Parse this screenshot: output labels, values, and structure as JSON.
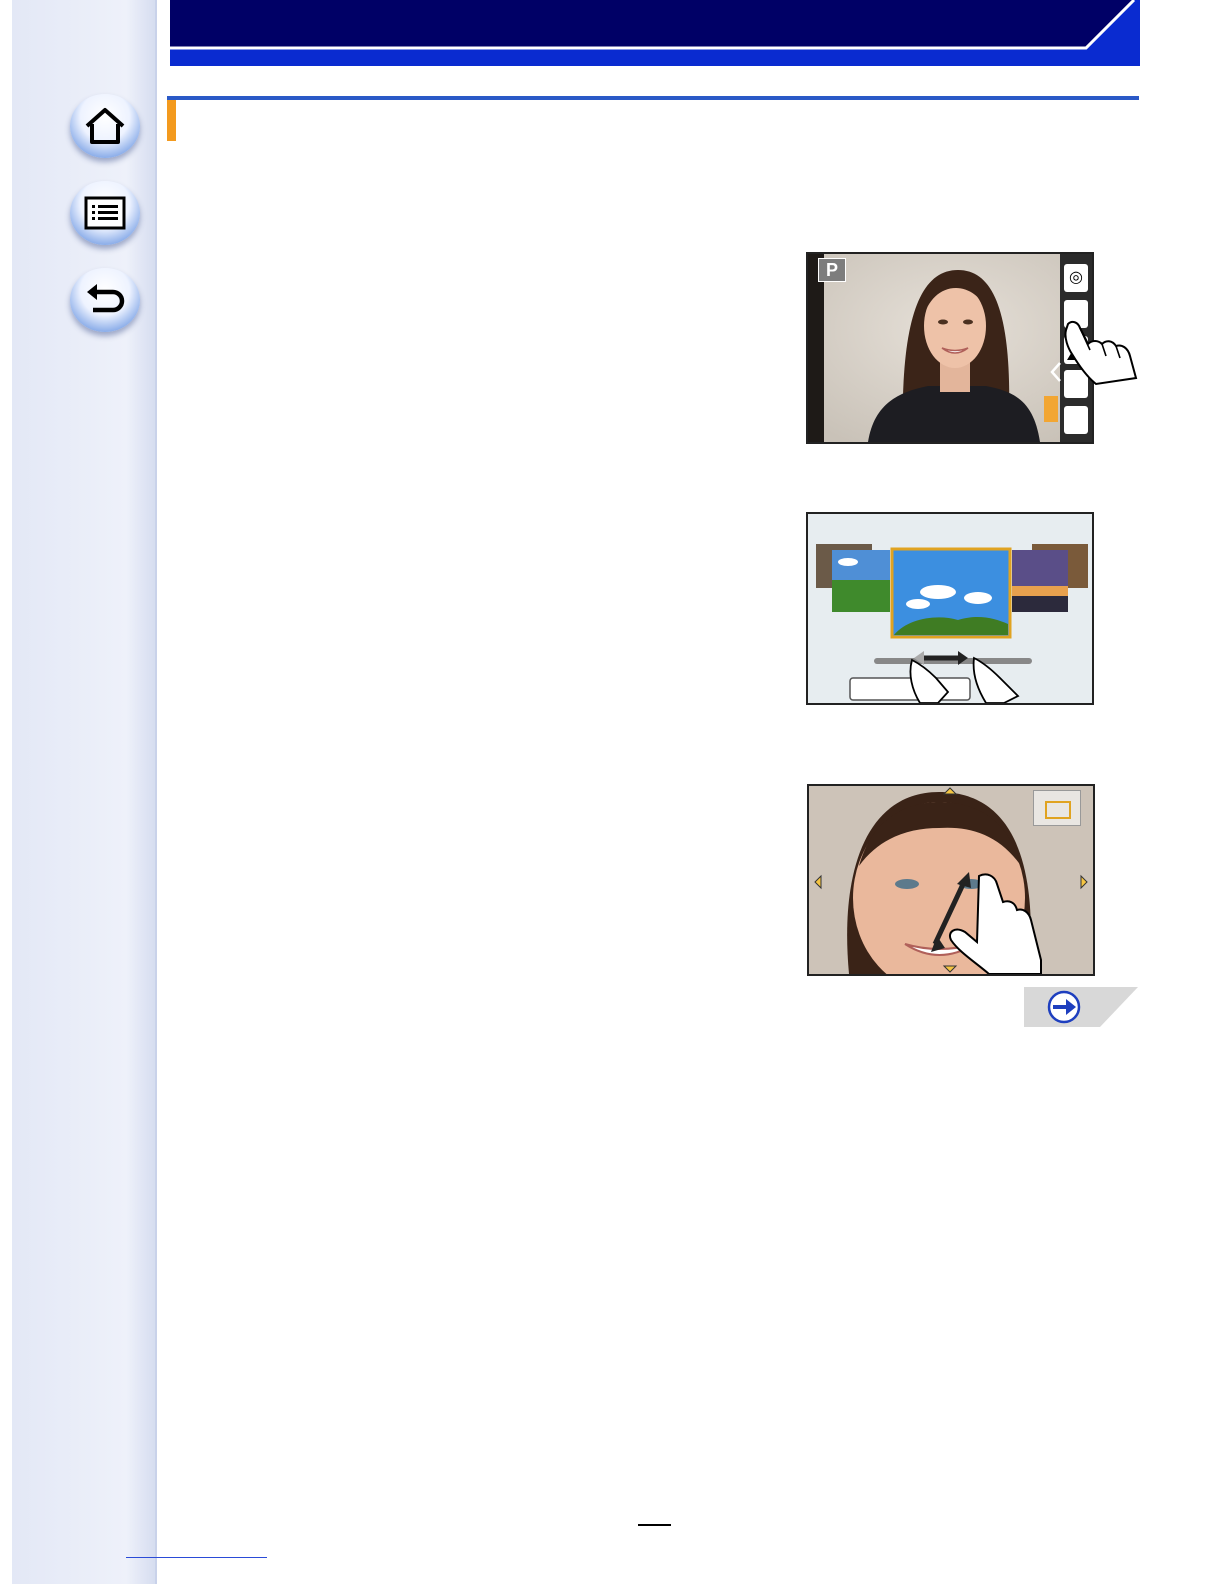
{
  "sidebar": {
    "buttons": [
      {
        "name": "home",
        "icon": "home-icon"
      },
      {
        "name": "menu",
        "icon": "list-icon"
      },
      {
        "name": "back",
        "icon": "return-icon"
      }
    ]
  },
  "screenshots": {
    "recording": {
      "mode_badge": "P",
      "touch_tabs": [
        "aperture-icon",
        "scene-icon",
        "landscape-icon"
      ]
    },
    "scene_select": {
      "frames": [
        "beach",
        "field",
        "sky",
        "twilight",
        "sunset"
      ]
    },
    "face_zoom": {
      "arrows": [
        "up",
        "down",
        "left",
        "right"
      ]
    }
  },
  "next_page": {
    "icon": "right-arrow-icon"
  },
  "colors": {
    "header_navy": "#000066",
    "header_blue": "#0a2bd0",
    "rule_blue": "#2a59c7",
    "accent_orange": "#f39a1e",
    "frame_gold": "#e0a321"
  }
}
